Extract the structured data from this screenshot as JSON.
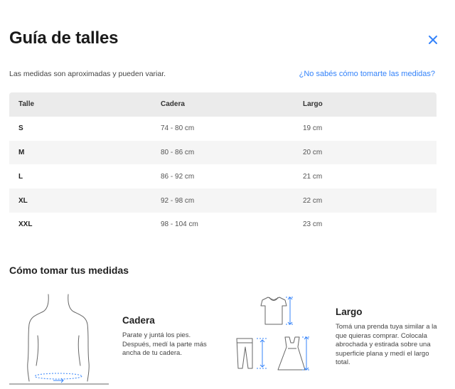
{
  "header": {
    "title": "Guía de talles",
    "close_icon": "close-icon"
  },
  "intro": {
    "note": "Las medidas son aproximadas y pueden variar.",
    "help_link": "¿No sabés cómo tomarte las medidas?"
  },
  "accent_color": "#3483fa",
  "table": {
    "columns": [
      "Talle",
      "Cadera",
      "Largo"
    ],
    "rows": [
      [
        "S",
        "74 - 80 cm",
        "19 cm"
      ],
      [
        "M",
        "80 - 86 cm",
        "20 cm"
      ],
      [
        "L",
        "86 - 92 cm",
        "21 cm"
      ],
      [
        "XL",
        "92 - 98 cm",
        "22 cm"
      ],
      [
        "XXL",
        "98 - 104 cm",
        "23 cm"
      ]
    ]
  },
  "how_to": {
    "title": "Cómo tomar tus medidas",
    "cadera": {
      "title": "Cadera",
      "description": "Parate y juntá los pies. Después, medí la parte más ancha de tu cadera.",
      "icon": "body-hip-measure-icon"
    },
    "largo": {
      "title": "Largo",
      "description": "Tomá una prenda tuya similar a la que quieras comprar. Colocala abrochada y estirada sobre una superficie plana y medí el largo total.",
      "icon": "garment-length-measure-icon"
    }
  }
}
